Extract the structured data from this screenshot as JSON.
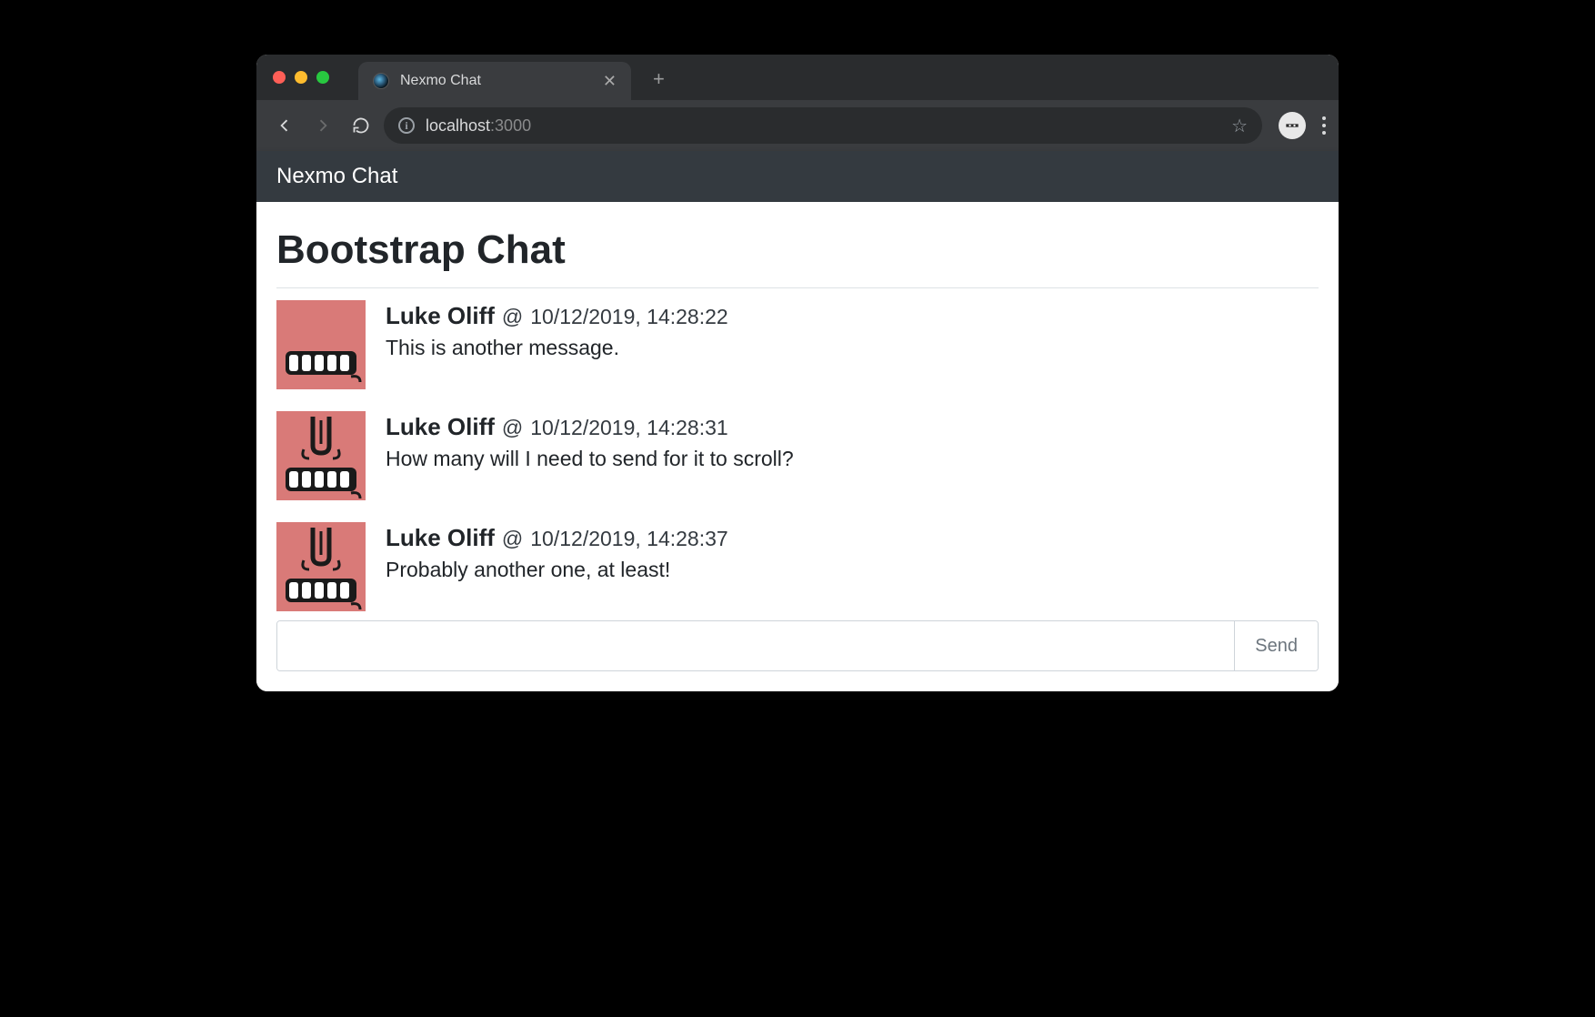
{
  "window": {
    "tab_title": "Nexmo Chat",
    "url_host": "localhost",
    "url_port": ":3000"
  },
  "navbar": {
    "brand": "Nexmo Chat"
  },
  "page": {
    "title": "Bootstrap Chat"
  },
  "messages": [
    {
      "user": "Luke Oliff",
      "sep": "@",
      "time": "10/12/2019, 14:28:22",
      "text": "This is another message."
    },
    {
      "user": "Luke Oliff",
      "sep": "@",
      "time": "10/12/2019, 14:28:31",
      "text": "How many will I need to send for it to scroll?"
    },
    {
      "user": "Luke Oliff",
      "sep": "@",
      "time": "10/12/2019, 14:28:37",
      "text": "Probably another one, at least!"
    }
  ],
  "compose": {
    "placeholder": "",
    "send_label": "Send"
  }
}
